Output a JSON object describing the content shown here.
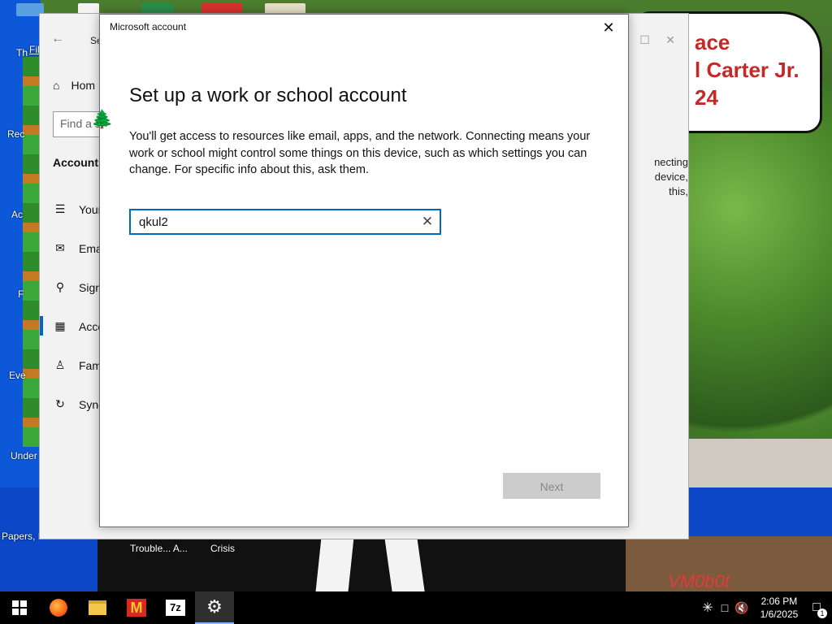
{
  "desktop": {
    "wallpaper_text": [
      "ace",
      "l Carter Jr.",
      "24"
    ],
    "left_labels": [
      "Th",
      "Fil",
      "Rec",
      "Ac",
      "F",
      "Eve",
      "Under",
      "Papers, P"
    ],
    "bottom_labels": [
      "Trouble... A...",
      "Crisis"
    ],
    "watermark": "VM0b0t"
  },
  "settings": {
    "title": "Se",
    "home_label": "Hom",
    "find_placeholder": "Find a s",
    "section_heading": "Accounts",
    "items": [
      {
        "label": "Your",
        "icon": "person-card-icon"
      },
      {
        "label": "Ema",
        "icon": "mail-icon"
      },
      {
        "label": "Sign",
        "icon": "key-icon"
      },
      {
        "label": "Acce",
        "icon": "briefcase-icon"
      },
      {
        "label": "Fam",
        "icon": "family-icon"
      },
      {
        "label": "Sync",
        "icon": "sync-icon"
      }
    ],
    "right_text": [
      "necting",
      "device,",
      "this,"
    ]
  },
  "dialog": {
    "title": "Microsoft account",
    "heading": "Set up a work or school account",
    "body": "You'll get access to resources like email, apps, and the network. Connecting means your work or school might control some things on this device, such as which settings you can change. For specific info about this, ask them.",
    "input_value": "qkul2",
    "next_label": "Next"
  },
  "taskbar": {
    "apps": [
      "start-icon",
      "firefox-icon",
      "file-explorer-icon",
      "mcdonalds-icon",
      "7zip-icon",
      "settings-gear-icon"
    ],
    "time": "2:06 PM",
    "date": "1/6/2025",
    "notification_count": "1"
  },
  "colors": {
    "accent": "#0067c0",
    "taskbar": "#000000",
    "next_disabled_bg": "#cccccc"
  }
}
